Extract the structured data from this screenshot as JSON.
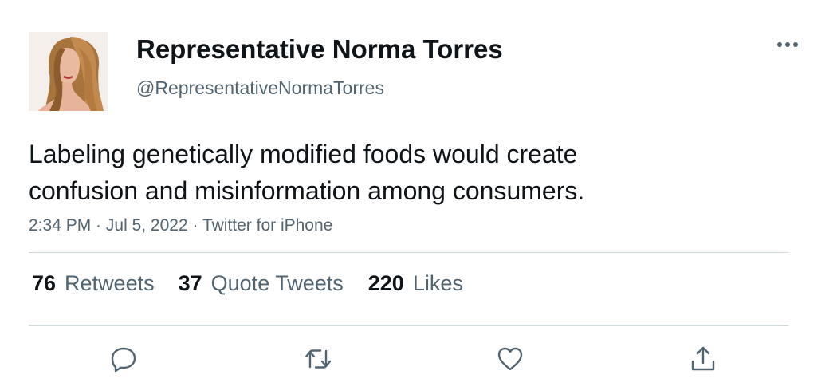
{
  "author": {
    "name": "Representative Norma Torres",
    "handle": "@RepresentativeNormaTorres"
  },
  "tweet": {
    "text_lines": [
      "Labeling genetically modified foods would create",
      "confusion and misinformation among consumers."
    ],
    "time": "2:34 PM",
    "date": "Jul 5, 2022",
    "source": "Twitter for iPhone",
    "separator": " · "
  },
  "stats": {
    "retweets_count": "76",
    "retweets_label": "Retweets",
    "quotes_count": "37",
    "quotes_label": "Quote Tweets",
    "likes_count": "220",
    "likes_label": "Likes"
  },
  "icons": {
    "more": "more-horizontal-icon",
    "reply": "reply-icon",
    "retweet": "retweet-icon",
    "like": "heart-icon",
    "share": "share-icon"
  },
  "colors": {
    "text_primary": "#0f1419",
    "text_secondary": "#536471",
    "divider": "#cfd9de"
  }
}
